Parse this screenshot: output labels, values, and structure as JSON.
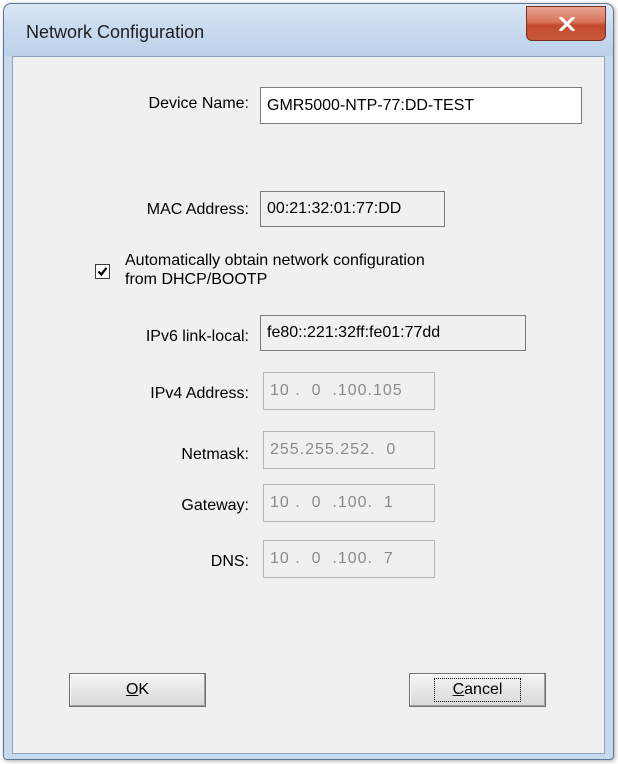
{
  "window": {
    "title": "Network Configuration",
    "close_glyph": "X"
  },
  "form": {
    "device_name": {
      "label": "Device Name:",
      "value": "GMR5000-NTP-77:DD-TEST"
    },
    "mac_address": {
      "label": "MAC Address:",
      "value": "00:21:32:01:77:DD"
    },
    "dhcp": {
      "line1": "Automatically obtain network configuration",
      "line2": "from DHCP/BOOTP",
      "checked": true
    },
    "ipv6_link_local": {
      "label": "IPv6 link-local:",
      "value": "fe80::221:32ff:fe01:77dd"
    },
    "ipv4_address": {
      "label": "IPv4 Address:",
      "value": "10 .  0  .100.105"
    },
    "netmask": {
      "label": "Netmask:",
      "value": "255.255.252.  0"
    },
    "gateway": {
      "label": "Gateway:",
      "value": "10 .  0  .100.  1"
    },
    "dns": {
      "label": "DNS:",
      "value": "10 .  0  .100.  7"
    }
  },
  "buttons": {
    "ok_mnemonic": "O",
    "ok_rest": "K",
    "cancel_mnemonic": "C",
    "cancel_rest": "ancel"
  }
}
